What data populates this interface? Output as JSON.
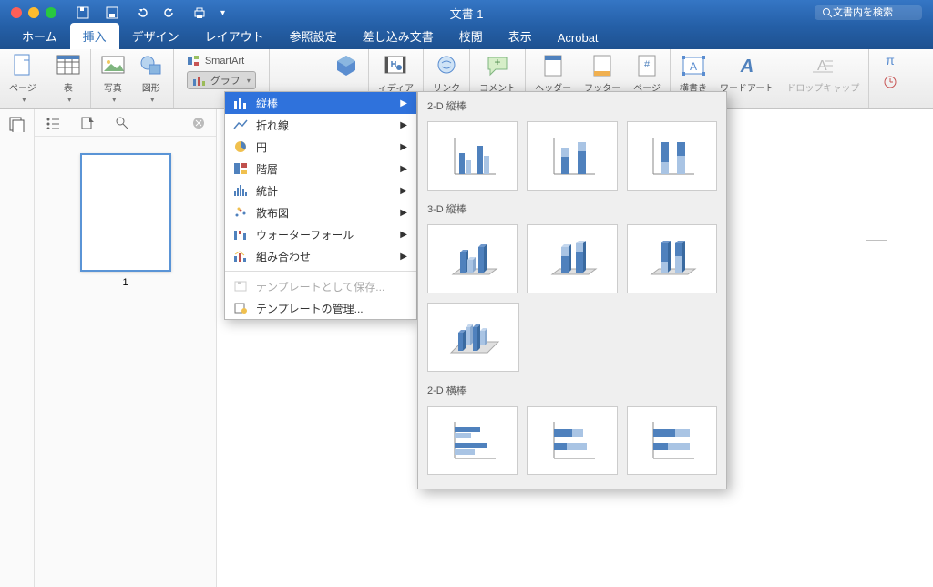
{
  "window": {
    "title": "文書 1",
    "search_placeholder": "文書内を検索"
  },
  "tabs": [
    "ホーム",
    "挿入",
    "デザイン",
    "レイアウト",
    "参照設定",
    "差し込み文書",
    "校閲",
    "表示",
    "Acrobat"
  ],
  "active_tab": 1,
  "ribbon": {
    "page": "ページ",
    "table": "表",
    "photo": "写真",
    "shapes": "図形",
    "smartart": "SmartArt",
    "chart": "グラフ",
    "media_partial": "ィディア",
    "link": "リンク",
    "comment": "コメント",
    "header": "ヘッダー",
    "footer": "フッター",
    "page_no": "ページ",
    "textbox": "横書き",
    "wordart": "ワードアート",
    "dropcap": "ドロップキャップ"
  },
  "thumb": {
    "page_no": "1"
  },
  "chart_menu": {
    "items": [
      {
        "key": "column",
        "label": "縦棒",
        "sel": true
      },
      {
        "key": "line",
        "label": "折れ線",
        "sel": false
      },
      {
        "key": "pie",
        "label": "円",
        "sel": false
      },
      {
        "key": "hierarchy",
        "label": "階層",
        "sel": false
      },
      {
        "key": "stats",
        "label": "統計",
        "sel": false
      },
      {
        "key": "scatter",
        "label": "散布図",
        "sel": false
      },
      {
        "key": "waterfall",
        "label": "ウォーターフォール",
        "sel": false
      },
      {
        "key": "combo",
        "label": "組み合わせ",
        "sel": false
      }
    ],
    "save_template": "テンプレートとして保存...",
    "manage_templates": "テンプレートの管理..."
  },
  "column_sub": {
    "h_2d_col": "2-D 縦棒",
    "h_3d_col": "3-D 縦棒",
    "h_2d_bar": "2-D 横棒"
  }
}
